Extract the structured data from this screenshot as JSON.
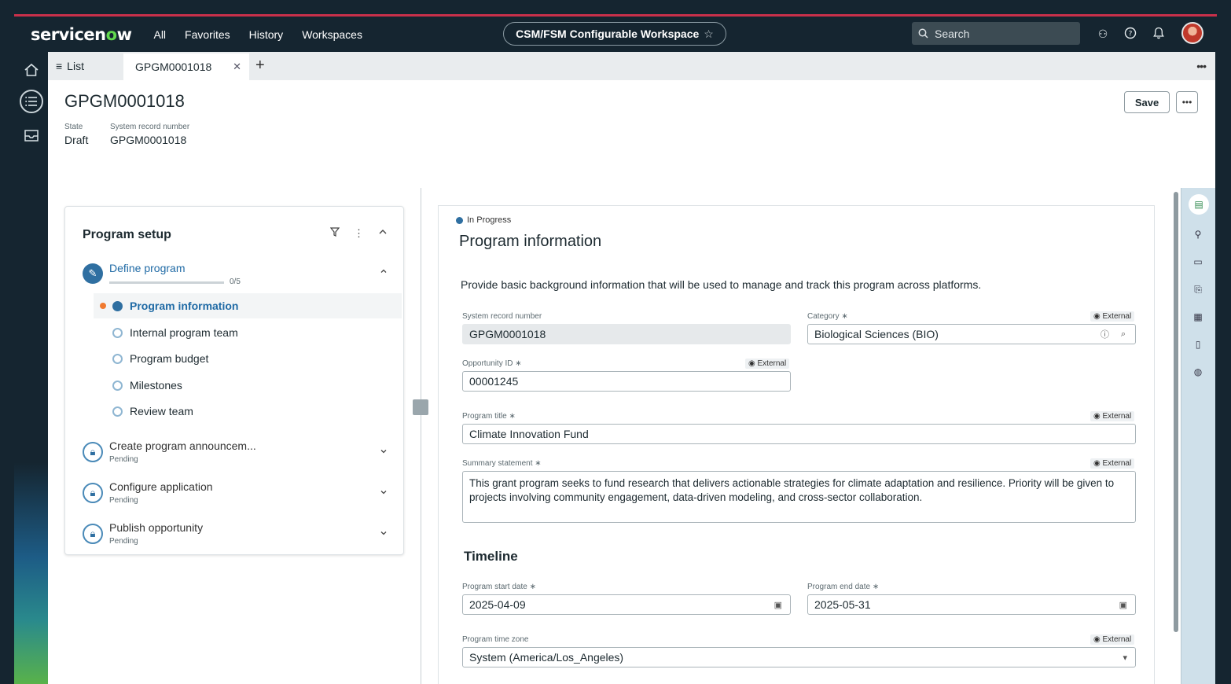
{
  "header": {
    "logo": {
      "pre": "servicen",
      "o": "o",
      "post": "w"
    },
    "nav": [
      "All",
      "Favorites",
      "History",
      "Workspaces"
    ],
    "workspace": "CSM/FSM Configurable Workspace",
    "search_placeholder": "Search"
  },
  "tabs": {
    "list_label": "List",
    "active_label": "GPGM0001018"
  },
  "record": {
    "title": "GPGM0001018",
    "state_label": "State",
    "state_value": "Draft",
    "sysnum_label": "System record number",
    "sysnum_value": "GPGM0001018",
    "save_label": "Save"
  },
  "setup": {
    "title": "Program setup",
    "define": {
      "label": "Define program",
      "progress_text": "0/5",
      "progress": 0
    },
    "subitems": [
      "Program information",
      "Internal program team",
      "Program budget",
      "Milestones",
      "Review team"
    ],
    "steps": [
      {
        "label": "Create program announcem...",
        "status": "Pending"
      },
      {
        "label": "Configure application",
        "status": "Pending"
      },
      {
        "label": "Publish opportunity",
        "status": "Pending"
      }
    ]
  },
  "form": {
    "status": "In Progress",
    "title": "Program information",
    "intro": "Provide basic background information that will be used to manage and track this program across platforms.",
    "external_tag": "External",
    "sysnum_label": "System record number",
    "sysnum_value": "GPGM0001018",
    "category_label": "Category ∗",
    "category_value": "Biological Sciences (BIO)",
    "opp_label": "Opportunity ID ∗",
    "opp_value": "00001245",
    "prog_title_label": "Program title ∗",
    "prog_title_value": "Climate Innovation Fund",
    "summary_label": "Summary statement ∗",
    "summary_value": "This grant program seeks to fund research that delivers actionable strategies for climate adaptation and resilience. Priority will be given to projects involving community engagement, data-driven modeling, and cross-sector collaboration.",
    "timeline_title": "Timeline",
    "start_label": "Program start date ∗",
    "start_value": "2025-04-09",
    "end_label": "Program end date ∗",
    "end_value": "2025-05-31",
    "tz_label": "Program time zone",
    "tz_value": "System (America/Los_Angeles)"
  }
}
